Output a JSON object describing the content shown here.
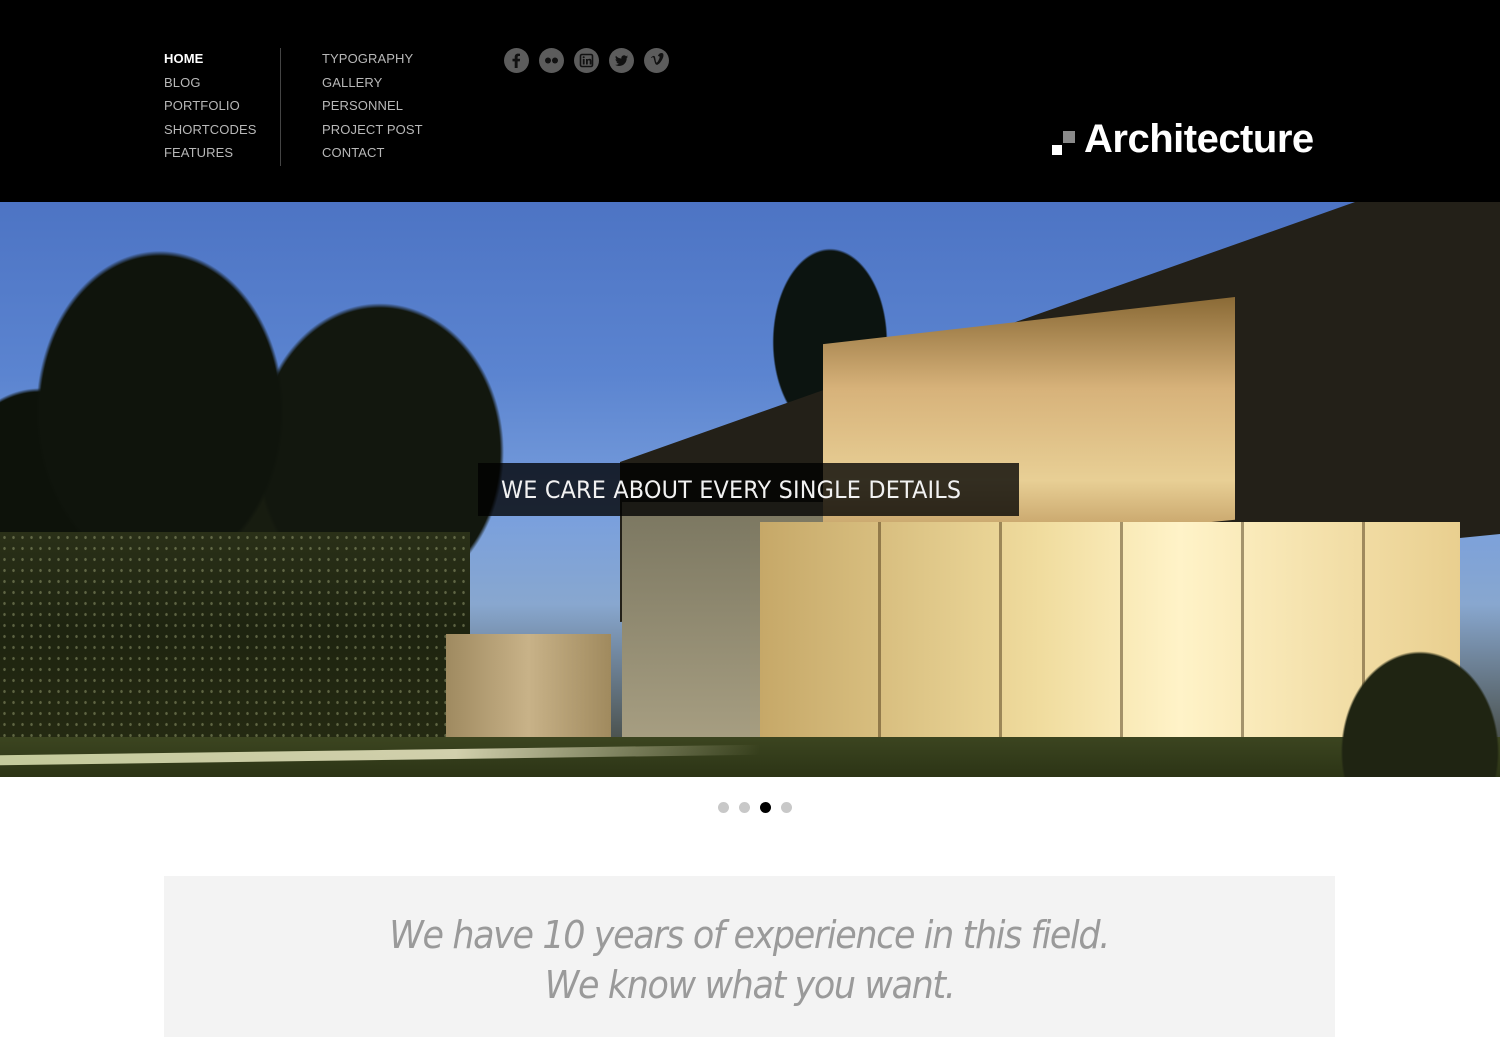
{
  "header": {
    "nav_primary": [
      {
        "label": "HOME",
        "active": true
      },
      {
        "label": "BLOG",
        "active": false
      },
      {
        "label": "PORTFOLIO",
        "active": false
      },
      {
        "label": "SHORTCODES",
        "active": false
      },
      {
        "label": "FEATURES",
        "active": false
      }
    ],
    "nav_secondary": [
      {
        "label": "TYPOGRAPHY"
      },
      {
        "label": "GALLERY"
      },
      {
        "label": "PERSONNEL"
      },
      {
        "label": "PROJECT POST"
      },
      {
        "label": "CONTACT"
      }
    ],
    "social_icons": [
      "facebook-icon",
      "flickr-icon",
      "linkedin-icon",
      "twitter-icon",
      "vimeo-icon"
    ],
    "logo_text": "Architecture"
  },
  "hero": {
    "caption": "WE CARE ABOUT EVERY SINGLE DETAILS",
    "slide_count": 4,
    "active_slide": 3
  },
  "tagline": {
    "line1": "We have 10 years of experience in this field.",
    "line2": "We know what you want."
  },
  "colors": {
    "header_bg": "#000000",
    "nav_text": "#b8b8b8",
    "nav_active": "#ffffff",
    "social_icon_bg": "#5c5c5c",
    "dot_inactive": "#c8c8c8",
    "dot_active": "#000000",
    "tagline_bg": "#f3f3f3",
    "tagline_text": "#9a9a9a"
  }
}
